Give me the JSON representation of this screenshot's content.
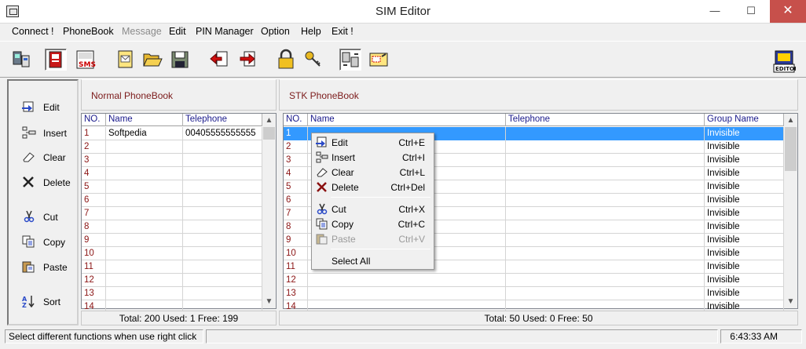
{
  "window": {
    "title": "SIM Editor",
    "minimize": "—",
    "maximize": "☐",
    "close": "✕"
  },
  "menu": [
    {
      "label": "Connect !",
      "disabled": false
    },
    {
      "label": "PhoneBook",
      "disabled": false
    },
    {
      "label": "Message",
      "disabled": true
    },
    {
      "label": "Edit",
      "disabled": false
    },
    {
      "label": "PIN Manager",
      "disabled": false
    },
    {
      "label": "Option",
      "disabled": false
    },
    {
      "label": "Help",
      "disabled": false
    },
    {
      "label": "Exit !",
      "disabled": false
    }
  ],
  "toolbar_icons": [
    "connect-icon",
    "phonebook-icon",
    "sms-icon",
    "message-icon",
    "open-folder-icon",
    "save-icon",
    "import-icon",
    "export-icon",
    "lock-icon",
    "key-icon",
    "transfer-icon",
    "new-window-icon"
  ],
  "logo": {
    "text": "EDITOR"
  },
  "sidebar": [
    {
      "label": "Edit",
      "icon": "edit-icon"
    },
    {
      "label": "Insert",
      "icon": "insert-icon"
    },
    {
      "label": "Clear",
      "icon": "clear-icon"
    },
    {
      "label": "Delete",
      "icon": "delete-icon"
    },
    {
      "label": "Cut",
      "icon": "cut-icon"
    },
    {
      "label": "Copy",
      "icon": "copy-icon"
    },
    {
      "label": "Paste",
      "icon": "paste-icon"
    },
    {
      "label": "Sort",
      "icon": "sort-icon"
    }
  ],
  "normal": {
    "header": "Normal PhoneBook",
    "columns": [
      "NO.",
      "Name",
      "Telephone"
    ],
    "rows": [
      [
        "1",
        "Softpedia",
        "00405555555555"
      ],
      [
        "2",
        "",
        ""
      ],
      [
        "3",
        "",
        ""
      ],
      [
        "4",
        "",
        ""
      ],
      [
        "5",
        "",
        ""
      ],
      [
        "6",
        "",
        ""
      ],
      [
        "7",
        "",
        ""
      ],
      [
        "8",
        "",
        ""
      ],
      [
        "9",
        "",
        ""
      ],
      [
        "10",
        "",
        ""
      ],
      [
        "11",
        "",
        ""
      ],
      [
        "12",
        "",
        ""
      ],
      [
        "13",
        "",
        ""
      ],
      [
        "14",
        "",
        ""
      ]
    ],
    "footer": "Total: 200  Used: 1  Free: 199"
  },
  "stk": {
    "header": "STK PhoneBook",
    "columns": [
      "NO.",
      "Name",
      "Telephone",
      "Group Name"
    ],
    "rows": [
      [
        "1",
        "",
        "",
        "Invisible"
      ],
      [
        "2",
        "",
        "",
        "Invisible"
      ],
      [
        "3",
        "",
        "",
        "Invisible"
      ],
      [
        "4",
        "",
        "",
        "Invisible"
      ],
      [
        "5",
        "",
        "",
        "Invisible"
      ],
      [
        "6",
        "",
        "",
        "Invisible"
      ],
      [
        "7",
        "",
        "",
        "Invisible"
      ],
      [
        "8",
        "",
        "",
        "Invisible"
      ],
      [
        "9",
        "",
        "",
        "Invisible"
      ],
      [
        "10",
        "",
        "",
        "Invisible"
      ],
      [
        "11",
        "",
        "",
        "Invisible"
      ],
      [
        "12",
        "",
        "",
        "Invisible"
      ],
      [
        "13",
        "",
        "",
        "Invisible"
      ],
      [
        "14",
        "",
        "",
        "Invisible"
      ]
    ],
    "footer": "Total: 50  Used: 0  Free: 50"
  },
  "context_menu": [
    {
      "label": "Edit",
      "key": "Ctrl+E",
      "icon": "edit-icon",
      "disabled": false
    },
    {
      "label": "Insert",
      "key": "Ctrl+I",
      "icon": "insert-icon",
      "disabled": false
    },
    {
      "label": "Clear",
      "key": "Ctrl+L",
      "icon": "clear-icon",
      "disabled": false
    },
    {
      "label": "Delete",
      "key": "Ctrl+Del",
      "icon": "delete-icon",
      "disabled": false
    },
    {
      "label": "Cut",
      "key": "Ctrl+X",
      "icon": "cut-icon",
      "disabled": false
    },
    {
      "label": "Copy",
      "key": "Ctrl+C",
      "icon": "copy-icon",
      "disabled": false
    },
    {
      "label": "Paste",
      "key": "Ctrl+V",
      "icon": "paste-icon",
      "disabled": true
    },
    {
      "label": "Select All",
      "key": "",
      "icon": "",
      "disabled": false
    }
  ],
  "status": {
    "message": "Select different functions when use right click",
    "time": "6:43:33 AM"
  },
  "colors": {
    "selection": "#3399ff",
    "row_number": "#8b1414",
    "header_text": "#1a1a8c",
    "close_button": "#c7504b"
  }
}
